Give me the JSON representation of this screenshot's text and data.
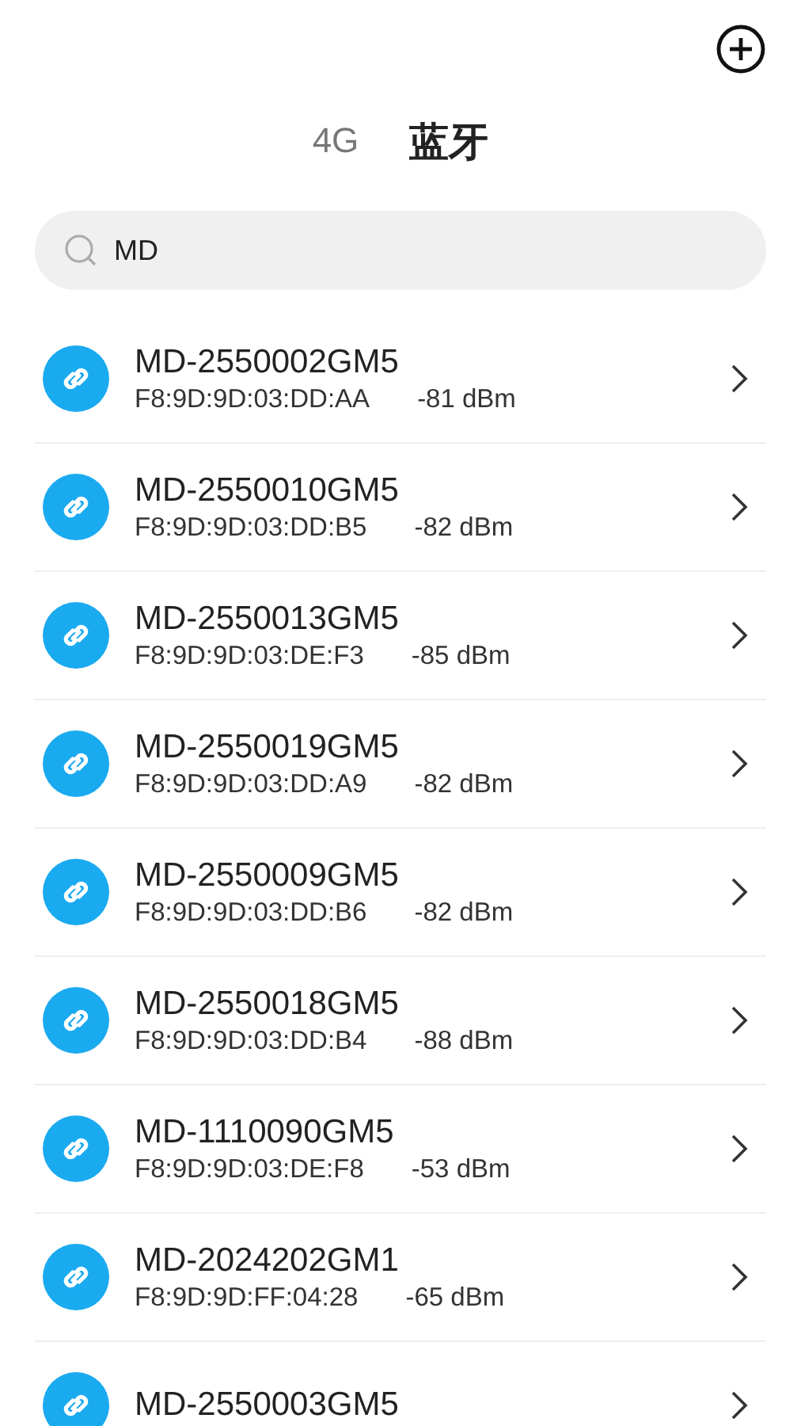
{
  "tabs": [
    {
      "label": "4G",
      "selected": false
    },
    {
      "label": "蓝牙",
      "selected": true
    }
  ],
  "search": {
    "value": "MD"
  },
  "devices": [
    {
      "name": "MD-2550002GM5",
      "mac": "F8:9D:9D:03:DD:AA",
      "rssi": "-81 dBm"
    },
    {
      "name": "MD-2550010GM5",
      "mac": "F8:9D:9D:03:DD:B5",
      "rssi": "-82 dBm"
    },
    {
      "name": "MD-2550013GM5",
      "mac": "F8:9D:9D:03:DE:F3",
      "rssi": "-85 dBm"
    },
    {
      "name": "MD-2550019GM5",
      "mac": "F8:9D:9D:03:DD:A9",
      "rssi": "-82 dBm"
    },
    {
      "name": "MD-2550009GM5",
      "mac": "F8:9D:9D:03:DD:B6",
      "rssi": "-82 dBm"
    },
    {
      "name": "MD-2550018GM5",
      "mac": "F8:9D:9D:03:DD:B4",
      "rssi": "-88 dBm"
    },
    {
      "name": "MD-1110090GM5",
      "mac": "F8:9D:9D:03:DE:F8",
      "rssi": "-53 dBm"
    },
    {
      "name": "MD-2024202GM1",
      "mac": "F8:9D:9D:FF:04:28",
      "rssi": "-65 dBm"
    },
    {
      "name": "MD-2550003GM5"
    }
  ]
}
